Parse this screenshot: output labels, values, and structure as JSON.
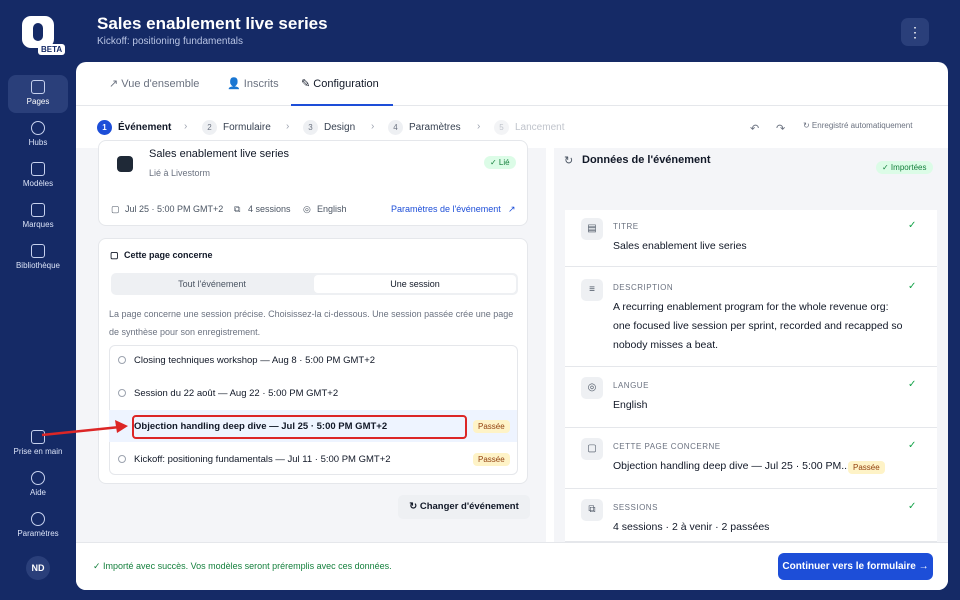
{
  "brand": {
    "badge": "BETA"
  },
  "sidebar": {
    "items": [
      {
        "label": "Pages"
      },
      {
        "label": "Hubs"
      },
      {
        "label": "Modèles"
      },
      {
        "label": "Marques"
      },
      {
        "label": "Bibliothèque"
      },
      {
        "label": "Prise en main"
      },
      {
        "label": "Aide"
      },
      {
        "label": "Paramètres"
      }
    ],
    "avatar": "ND"
  },
  "header": {
    "title": "Sales enablement live series",
    "subtitle": "Kickoff: positioning fundamentals",
    "menu": "⋮"
  },
  "tabs": [
    {
      "label": "Vue d'ensemble",
      "icon": "↗"
    },
    {
      "label": "Inscrits",
      "icon": "👤"
    },
    {
      "label": "Configuration",
      "icon": "✎"
    }
  ],
  "steps": [
    {
      "num": "1",
      "label": "Événement"
    },
    {
      "num": "2",
      "label": "Formulaire"
    },
    {
      "num": "3",
      "label": "Design"
    },
    {
      "num": "4",
      "label": "Paramètres"
    },
    {
      "num": "5",
      "label": "Lancement"
    }
  ],
  "toolbar": {
    "undo": "↶",
    "redo": "↷",
    "saved": "↻ Enregistré automatiquement"
  },
  "event_card": {
    "title": "Sales enablement live series",
    "source": "Lié à Livestorm",
    "status": "✓ Lié",
    "date": "Jul 25 · 5:00 PM GMT+2",
    "sessions": "4 sessions",
    "language": "English",
    "link": "Paramètres de l'événement"
  },
  "concern": {
    "title": "Cette page concerne",
    "options": [
      "Tout l'événement",
      "Une session"
    ],
    "help": "La page concerne une session précise. Choisissez-la ci-dessous. Une session passée crée une page de synthèse pour son enregistrement.",
    "sessions": [
      {
        "label": "Closing techniques workshop — Aug 8 · 5:00 PM GMT+2",
        "badge": ""
      },
      {
        "label": "Session du 22 août — Aug 22 · 5:00 PM GMT+2",
        "badge": ""
      },
      {
        "label": "Objection handling deep dive — Jul 25 · 5:00 PM GMT+2",
        "badge": "Passée"
      },
      {
        "label": "Kickoff: positioning fundamentals — Jul 11 · 5:00 PM GMT+2",
        "badge": "Passée"
      }
    ],
    "change_button": "↻ Changer d'événement"
  },
  "event_data": {
    "title": "Données de l'événement",
    "badge": "✓ Importées",
    "fields": [
      {
        "label": "TITRE",
        "value": "Sales enablement live series"
      },
      {
        "label": "DESCRIPTION",
        "value": "A recurring enablement program for the whole revenue org: one focused live session per sprint, recorded and recapped so nobody misses a beat."
      },
      {
        "label": "LANGUE",
        "value": "English"
      },
      {
        "label": "CETTE PAGE CONCERNE",
        "value": "Objection handling deep dive — Jul 25 · 5:00 PM...",
        "badge": "Passée"
      },
      {
        "label": "SESSIONS",
        "value": "4 sessions · 2 à venir · 2 passées"
      }
    ]
  },
  "footer": {
    "message": "✓ Importé avec succès. Vos modèles seront préremplis avec ces données.",
    "cta": "Continuer vers le formulaire →"
  },
  "colors": {
    "sidebar": "#152a66",
    "accent": "#1d4ed8",
    "highlight": "#dc2626",
    "success": "#15803d"
  }
}
